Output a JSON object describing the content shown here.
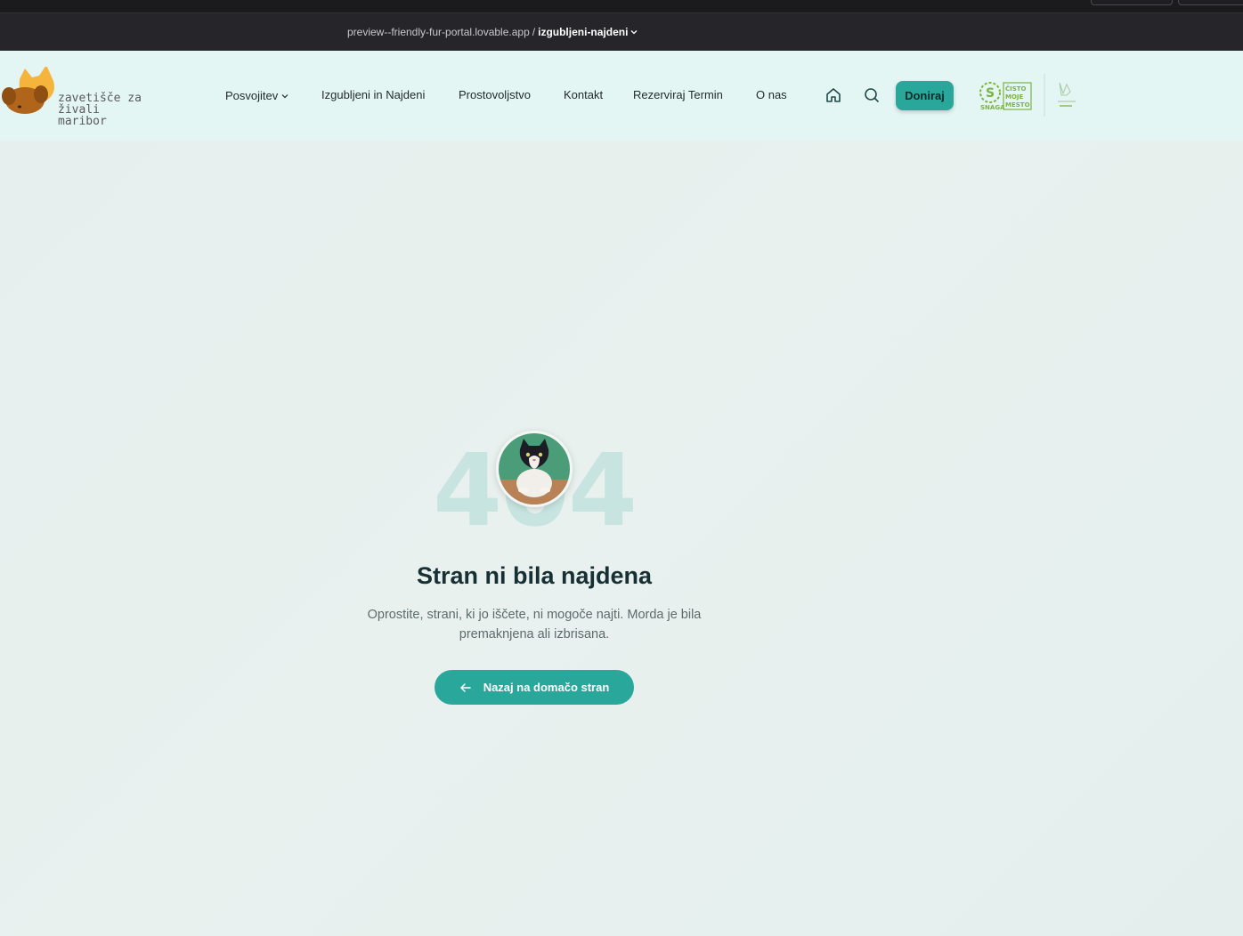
{
  "browser": {
    "url_domain": "preview--friendly-fur-portal.lovable.app",
    "url_separator": "/",
    "url_path": "izgubljeni-najdeni"
  },
  "logo": {
    "line1": "zavetišče za živali",
    "line2": "maribor"
  },
  "nav": {
    "items": [
      {
        "label": "Posvojitev",
        "has_dropdown": true
      },
      {
        "label": "Izgubljeni in Najdeni"
      },
      {
        "label": "Prostovoljstvo"
      },
      {
        "label": "Kontakt"
      },
      {
        "label": "Rezerviraj Termin"
      },
      {
        "label": "O nas"
      }
    ],
    "icons": [
      "home-icon",
      "search-icon"
    ],
    "donate_label": "Doniraj"
  },
  "partners": {
    "snaga_caption": "SNAGA",
    "cisto_line1": "ČISTO",
    "cisto_line2": "MOJE",
    "cisto_line3": "MESTO"
  },
  "error": {
    "code": "404",
    "title": "Stran ni bila najdena",
    "message": "Oprostite, strani, ki jo iščete, ni mogoče najti. Morda je bila premaknjena ali izbrisana.",
    "button_label": "Nazaj na domačo stran"
  },
  "colors": {
    "accent": "#2aa79b",
    "header_bg": "#e3f6f4",
    "code_color": "#c7e4e1",
    "title_color": "#173033"
  }
}
